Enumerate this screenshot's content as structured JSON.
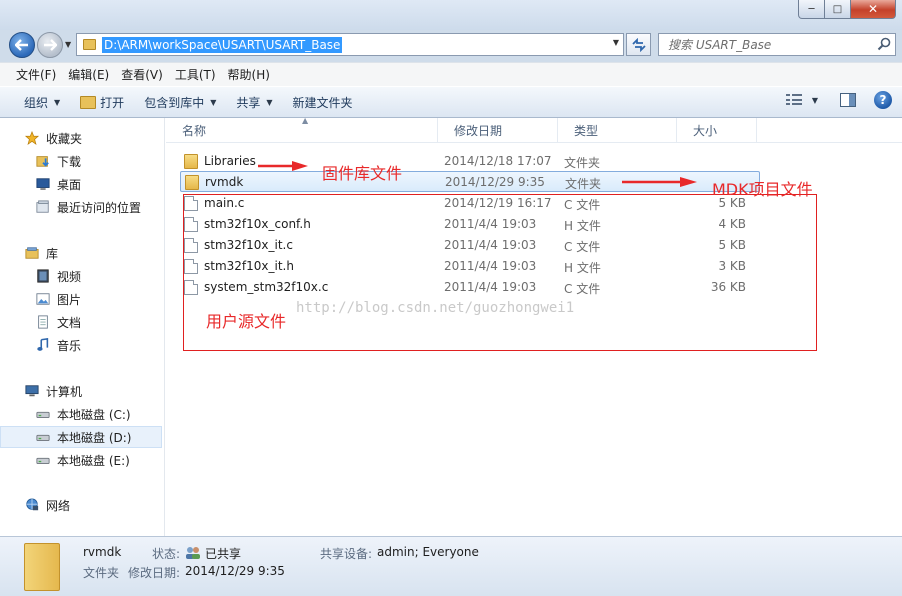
{
  "window": {
    "min_glyph": "─",
    "max_glyph": "□",
    "close_glyph": "✕"
  },
  "address": {
    "path": "D:\\ARM\\workSpace\\USART\\USART_Base",
    "search_placeholder": "搜索 USART_Base"
  },
  "menu": [
    "文件(F)",
    "编辑(E)",
    "查看(V)",
    "工具(T)",
    "帮助(H)"
  ],
  "commands": {
    "organize": "组织",
    "open": "打开",
    "include_library": "包含到库中",
    "share": "共享",
    "new_folder": "新建文件夹"
  },
  "nav": {
    "favorites": "收藏夹",
    "downloads": "下载",
    "desktop": "桌面",
    "recent": "最近访问的位置",
    "libraries": "库",
    "videos": "视频",
    "pictures": "图片",
    "documents": "文档",
    "music": "音乐",
    "computer": "计算机",
    "drive_c": "本地磁盘 (C:)",
    "drive_d": "本地磁盘 (D:)",
    "drive_e": "本地磁盘 (E:)",
    "network": "网络"
  },
  "columns": {
    "name": "名称",
    "modified": "修改日期",
    "type": "类型",
    "size": "大小"
  },
  "files": [
    {
      "name": "Libraries",
      "date": "2014/12/18 17:07",
      "type": "文件夹",
      "size": "",
      "kind": "folder"
    },
    {
      "name": "rvmdk",
      "date": "2014/12/29 9:35",
      "type": "文件夹",
      "size": "",
      "kind": "folder"
    },
    {
      "name": "main.c",
      "date": "2014/12/19 16:17",
      "type": "C 文件",
      "size": "5 KB",
      "kind": "file"
    },
    {
      "name": "stm32f10x_conf.h",
      "date": "2011/4/4 19:03",
      "type": "H 文件",
      "size": "4 KB",
      "kind": "file"
    },
    {
      "name": "stm32f10x_it.c",
      "date": "2011/4/4 19:03",
      "type": "C 文件",
      "size": "5 KB",
      "kind": "file"
    },
    {
      "name": "stm32f10x_it.h",
      "date": "2011/4/4 19:03",
      "type": "H 文件",
      "size": "3 KB",
      "kind": "file"
    },
    {
      "name": "system_stm32f10x.c",
      "date": "2011/4/4 19:03",
      "type": "C 文件",
      "size": "36 KB",
      "kind": "file"
    }
  ],
  "annotations": {
    "libraries_note": "固件库文件",
    "mdk_note": "MDK项目文件",
    "user_note": "用户源文件",
    "watermark": "http://blog.csdn.net/guozhongwei1",
    "color": "#e8292a"
  },
  "details": {
    "name": "rvmdk",
    "kind": "文件夹",
    "status_label": "状态:",
    "status_value": "已共享",
    "shared_with_label": "共享设备:",
    "shared_with_value": "admin; Everyone",
    "modified_label": "修改日期:",
    "modified_value": "2014/12/29 9:35"
  }
}
